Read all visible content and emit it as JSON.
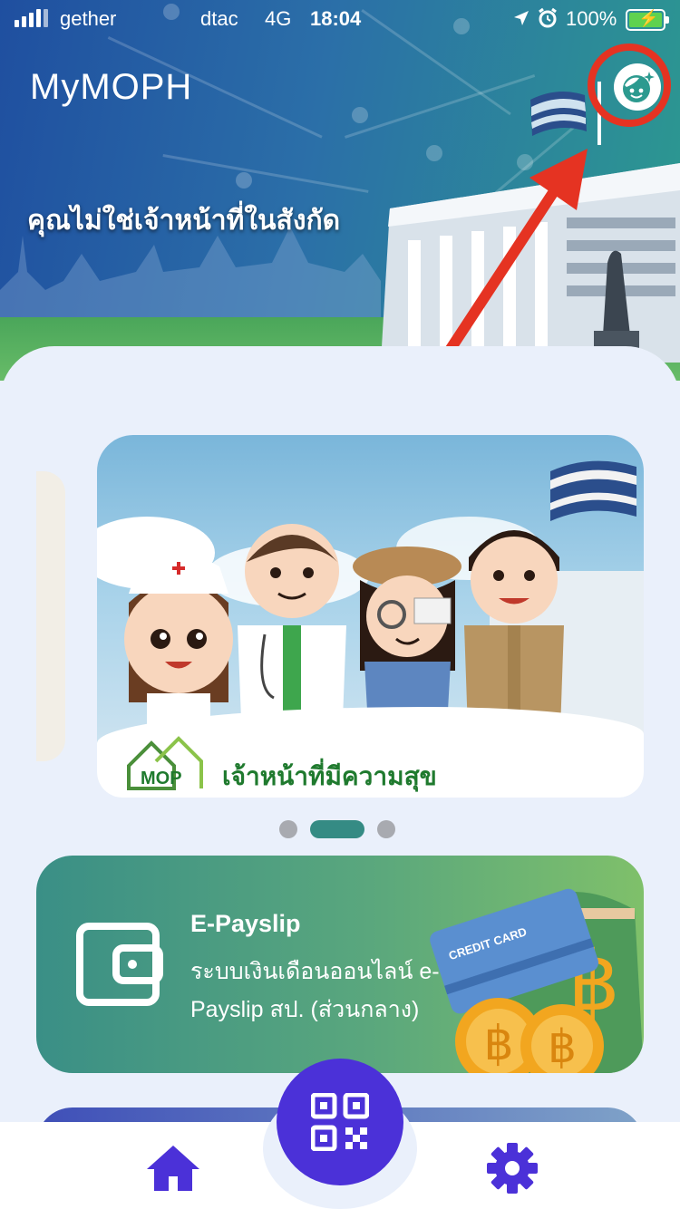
{
  "status_bar": {
    "carrier_left": "gether",
    "carrier": "dtac",
    "network": "4G",
    "time": "18:04",
    "battery": "100%"
  },
  "header": {
    "app_name": "MyMOPH",
    "message": "คุณไม่ใช่เจ้าหน้าที่ในสังกัด",
    "profile_icon": "face-sparkle-icon",
    "highlight_color": "#e53322"
  },
  "banner": {
    "tagline": "เจ้าหน้าที่มีความสุข",
    "logo_text": "MOP",
    "slide_count": 3,
    "active_slide": 2
  },
  "epayslip": {
    "title": "E-Payslip",
    "description_line1": "ระบบเงินเดือนออนไลน์ e-",
    "description_line2": "Payslip สป. (ส่วนกลาง)",
    "card_text": "CREDIT CARD",
    "currency_symbol": "฿"
  },
  "tab_bar": {
    "left_icon": "home-icon",
    "center_icon": "qr-code-icon",
    "right_icon": "gear-icon",
    "accent": "#4b31d8"
  }
}
